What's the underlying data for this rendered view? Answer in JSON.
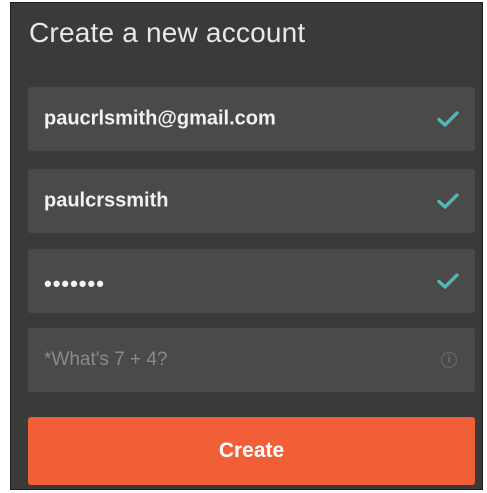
{
  "form": {
    "title": "Create a new account",
    "email": {
      "value": "paucrlsmith@gmail.com",
      "valid": true
    },
    "username": {
      "value": "paulcrssmith",
      "valid": true
    },
    "password": {
      "value": "•••••••",
      "valid": true
    },
    "captcha": {
      "placeholder": "*What's 7 + 4?",
      "value": ""
    },
    "submit_label": "Create"
  },
  "colors": {
    "panel_bg": "#3a3a38",
    "field_bg": "#4a4a48",
    "check_accent": "#4fb8b2",
    "button_bg": "#f05f37"
  },
  "icons": {
    "valid": "check-icon",
    "hint": "info-icon"
  }
}
